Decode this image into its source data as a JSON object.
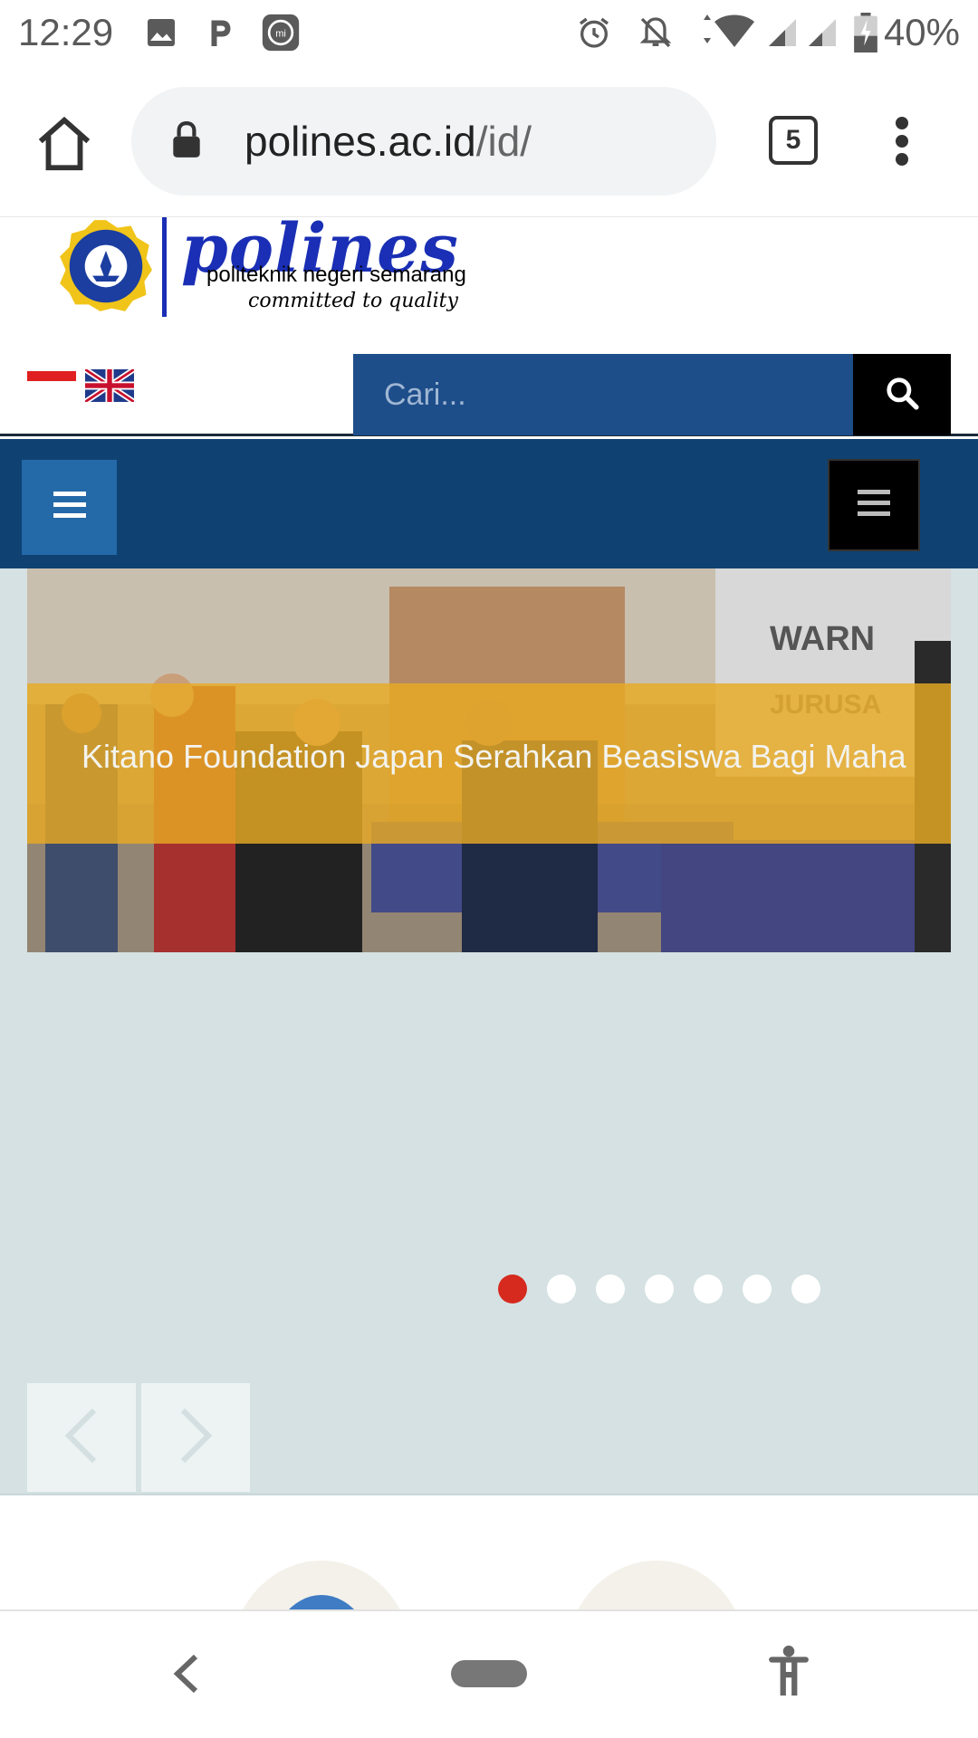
{
  "status_bar": {
    "time": "12:29",
    "battery": "40%",
    "icons": [
      "gallery-icon",
      "p-app-icon",
      "mi-app-icon",
      "alarm-icon",
      "notifications-off-icon",
      "wifi-icon",
      "signal-icon",
      "signal-icon-2",
      "battery-charging-icon"
    ]
  },
  "browser": {
    "url_domain": "polines.ac.id",
    "url_path": "/id/",
    "tab_count": "5",
    "icons": [
      "home-icon",
      "lock-icon",
      "tabs-icon",
      "more-vert-icon"
    ]
  },
  "site": {
    "logo_text": "polines",
    "logo_subtitle": "politeknik negeri semarang",
    "logo_tagline": "committed to quality",
    "search_placeholder": "Cari...",
    "languages": [
      "Indonesia",
      "English"
    ]
  },
  "slider": {
    "caption": "Kitano Foundation Japan Serahkan Beasiswa Bagi Maha",
    "slide_count": 7,
    "active_index": 0
  },
  "colors": {
    "nav_bar": "#0f4272",
    "search_bg": "#1e4e8a",
    "caption_band": "#e8aa23",
    "active_dot": "#d62a1e",
    "slider_bg": "#d5e1e2"
  }
}
